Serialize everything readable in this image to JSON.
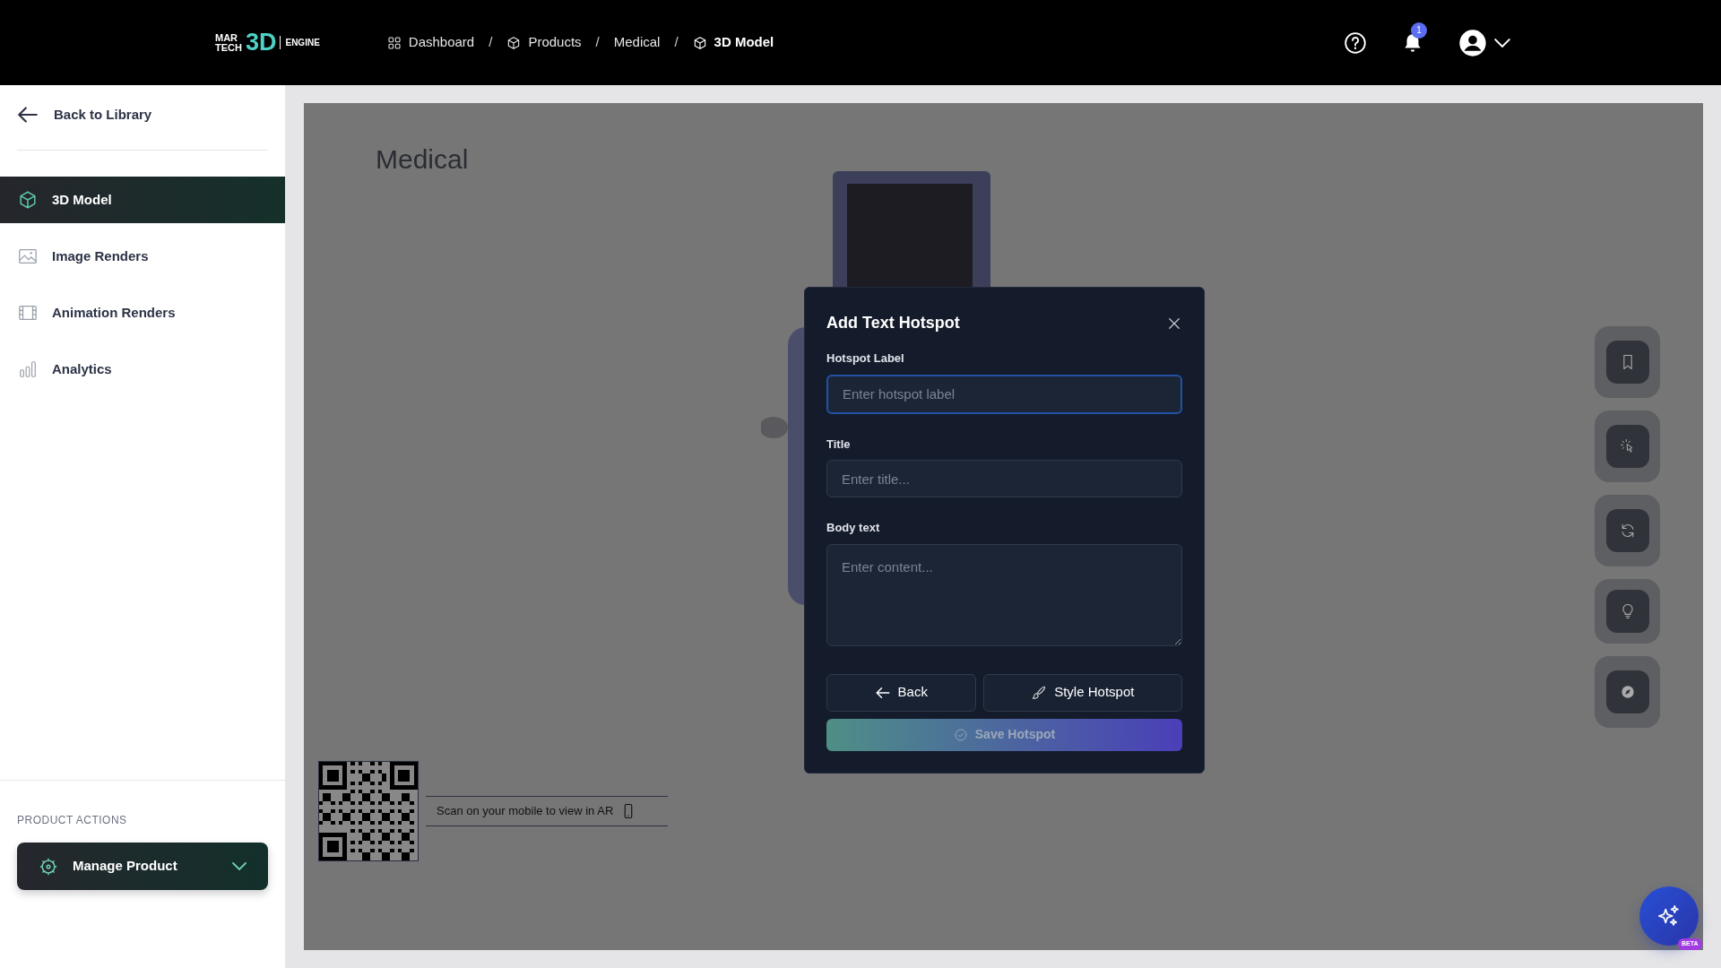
{
  "header": {
    "logo": {
      "line1": "MAR",
      "line2": "TECH",
      "mark": "3D",
      "word": "ENGINE"
    },
    "breadcrumbs": [
      {
        "label": "Dashboard",
        "current": false
      },
      {
        "label": "Products",
        "current": false
      },
      {
        "label": "Medical",
        "current": false
      },
      {
        "label": "3D Model",
        "current": true
      }
    ],
    "separator": "/",
    "notification_count": "1"
  },
  "sidebar": {
    "back": "Back to Library",
    "items": [
      {
        "label": "3D Model",
        "selected": true
      },
      {
        "label": "Image Renders",
        "selected": false
      },
      {
        "label": "Animation Renders",
        "selected": false
      },
      {
        "label": "Analytics",
        "selected": false
      }
    ],
    "section_title": "PRODUCT ACTIONS",
    "action_button": "Manage Product"
  },
  "viewer": {
    "title": "Medical",
    "qr_caption": "Scan on your mobile to view in AR",
    "assistant_badge": "BETA"
  },
  "modal": {
    "title": "Add Text Hotspot",
    "fields": [
      {
        "label": "Hotspot Label",
        "placeholder": "Enter hotspot label",
        "kind": "input",
        "focused": true
      },
      {
        "label": "Title",
        "placeholder": "Enter title...",
        "kind": "input",
        "focused": false
      },
      {
        "label": "Body text",
        "placeholder": "Enter content...",
        "kind": "textarea",
        "focused": false
      }
    ],
    "buttons": [
      {
        "label": "Back",
        "kind": "back"
      },
      {
        "label": "Style Hotspot",
        "kind": "style"
      }
    ],
    "save_button": {
      "label": "Save Hotspot",
      "disabled": true
    }
  }
}
